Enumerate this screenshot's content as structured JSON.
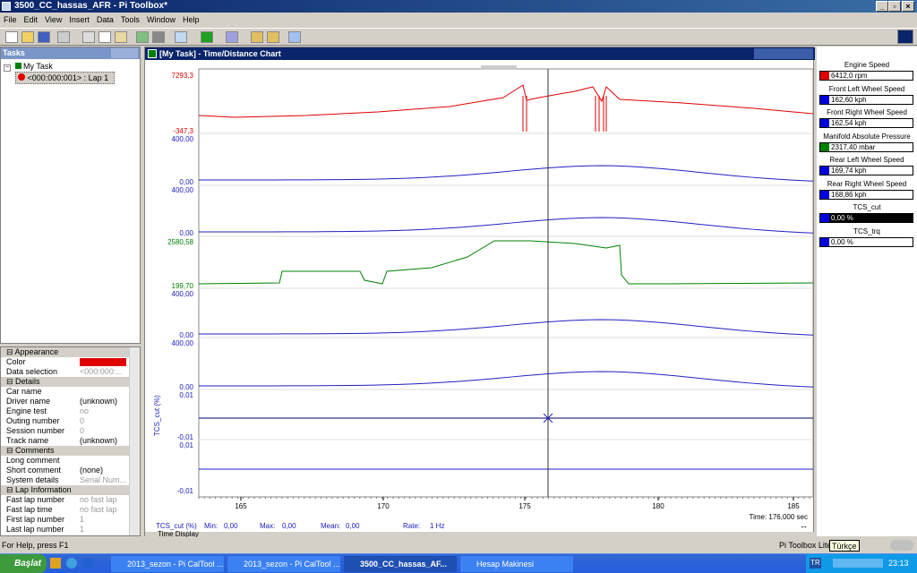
{
  "window": {
    "title": "3500_CC_hassas_AFR - Pi Toolbox*"
  },
  "menu": [
    "File",
    "Edit",
    "View",
    "Insert",
    "Data",
    "Tools",
    "Window",
    "Help"
  ],
  "tasks": {
    "header": "Tasks",
    "root": "My Task",
    "lap": "<000:000:001> : Lap 1"
  },
  "props": {
    "sections": [
      {
        "title": "Appearance",
        "rows": [
          {
            "k": "Color",
            "v": "",
            "swatch": "#e00000"
          },
          {
            "k": "Data selection",
            "v": "<000:000:...",
            "gray": true
          }
        ]
      },
      {
        "title": "Details",
        "rows": [
          {
            "k": "Car name",
            "v": ""
          },
          {
            "k": "Driver name",
            "v": "(unknown)"
          },
          {
            "k": "Engine test",
            "v": "no",
            "gray": true
          },
          {
            "k": "Outing number",
            "v": "0",
            "gray": true
          },
          {
            "k": "Session number",
            "v": "0",
            "gray": true
          },
          {
            "k": "Track name",
            "v": "(unknown)"
          }
        ]
      },
      {
        "title": "Comments",
        "rows": [
          {
            "k": "Long comment",
            "v": ""
          },
          {
            "k": "Short comment",
            "v": "(none)"
          },
          {
            "k": "System details",
            "v": "Serial Num...",
            "gray": true
          }
        ]
      },
      {
        "title": "Lap Information",
        "rows": [
          {
            "k": "Fast lap number",
            "v": "no fast lap",
            "gray": true
          },
          {
            "k": "Fast lap time",
            "v": "no fast lap",
            "gray": true
          },
          {
            "k": "First lap number",
            "v": "1",
            "gray": true
          },
          {
            "k": "Last lap number",
            "v": "1",
            "gray": true
          }
        ]
      }
    ]
  },
  "chart": {
    "window_title": "[My Task] - Time/Distance Chart",
    "y_labels": [
      {
        "text": "7293,3",
        "color": "#e00000"
      },
      {
        "text": "-347,3",
        "color": "#e00000"
      },
      {
        "text": "400,00",
        "color": "#2020c0"
      },
      {
        "text": "0,00",
        "color": "#2020c0"
      },
      {
        "text": "400,00",
        "color": "#2020c0"
      },
      {
        "text": "0,00",
        "color": "#2020c0"
      },
      {
        "text": "2580,58",
        "color": "#008000"
      },
      {
        "text": "199,70",
        "color": "#008000"
      },
      {
        "text": "400,00",
        "color": "#2020c0"
      },
      {
        "text": "0,00",
        "color": "#2020c0"
      },
      {
        "text": "400,00",
        "color": "#2020c0"
      },
      {
        "text": "0,00",
        "color": "#2020c0"
      },
      {
        "text": "0,01",
        "color": "#2020c0"
      },
      {
        "text": "-0,01",
        "color": "#2020c0"
      },
      {
        "text": "0,01",
        "color": "#2020c0"
      },
      {
        "text": "-0,01",
        "color": "#2020c0"
      }
    ],
    "axis_label": "TCS_cut (%)",
    "x_ticks": [
      "165",
      "170",
      "175",
      "180",
      "185"
    ],
    "time_readout": "Time: 176,000 sec",
    "stats": {
      "channel": "TCS_cut (%)",
      "min_label": "Min:",
      "min": "0,00",
      "max_label": "Max:",
      "max": "0,00",
      "mean_label": "Mean:",
      "mean": "0,00",
      "rate_label": "Rate:",
      "rate": "1 Hz"
    },
    "tab": "Time Display"
  },
  "values": [
    {
      "label": "Engine Speed",
      "value": "6412,0 rpm",
      "color": "#e00000"
    },
    {
      "label": "Front Left Wheel Speed",
      "value": "162,60 kph",
      "color": "#0000e0"
    },
    {
      "label": "Front Right Wheel Speed",
      "value": "162,54 kph",
      "color": "#0000e0"
    },
    {
      "label": "Manifold Absolute Pressure",
      "value": "2317,40 mbar",
      "color": "#008000"
    },
    {
      "label": "Rear Left Wheel Speed",
      "value": "169,74 kph",
      "color": "#0000e0"
    },
    {
      "label": "Rear Right Wheel Speed",
      "value": "168,86 kph",
      "color": "#0000e0"
    },
    {
      "label": "TCS_cut",
      "value": "0,00 %",
      "color": "#0000e0",
      "dark": true
    },
    {
      "label": "TCS_trq",
      "value": "0,00 %",
      "color": "#0000e0"
    }
  ],
  "status": {
    "help": "For Help, press F1",
    "product": "Pi Toolbox Lite",
    "lang": "Türkçe"
  },
  "taskbar": {
    "start": "Başlat",
    "buttons": [
      "2013_sezon - Pi CalTool ...",
      "2013_sezon - Pi CalTool ...",
      "3500_CC_hassas_AF...",
      "Hesap Makinesi"
    ],
    "clock": "23:13",
    "tray_lang": "TR"
  }
}
